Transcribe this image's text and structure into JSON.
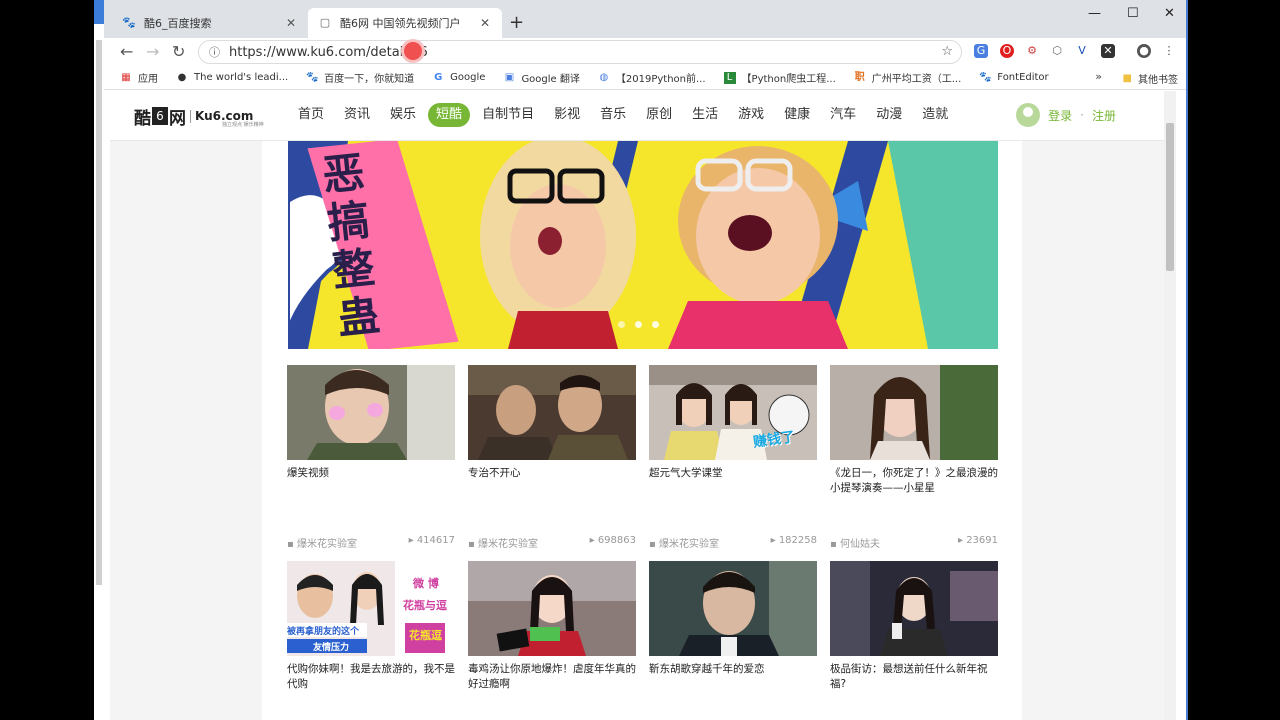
{
  "browser": {
    "tabs": [
      {
        "title": "酷6_百度搜索",
        "active": false
      },
      {
        "title": "酷6网 中国领先视频门户",
        "active": true
      }
    ],
    "url": "https://www.ku6.com/detail/76"
  },
  "bookmarks": {
    "apps_label": "应用",
    "items": [
      {
        "label": "The world's leadi...",
        "icon": "github-icon"
      },
      {
        "label": "百度一下，你就知道",
        "icon": "baidu-paw-icon"
      },
      {
        "label": "Google",
        "icon": "google-icon"
      },
      {
        "label": "Google 翻译",
        "icon": "translate-icon"
      },
      {
        "label": "【2019Python前...",
        "icon": "globe-icon"
      },
      {
        "label": "【Python爬虫工程...",
        "icon": "bookmark-l-icon"
      },
      {
        "label": "广州平均工资（工...",
        "icon": "bookmark-z-icon"
      },
      {
        "label": "FontEditor",
        "icon": "baidu-paw-icon"
      }
    ],
    "more": "»",
    "other": "其他书签"
  },
  "site": {
    "logo_cn_a": "酷",
    "logo_six": "6",
    "logo_cn_b": "网",
    "logo_domain": "Ku6.com",
    "logo_slogan": "独立观点 娱乐精神",
    "nav": [
      "首页",
      "资讯",
      "娱乐",
      "短酷",
      "自制节目",
      "影视",
      "音乐",
      "原创",
      "生活",
      "游戏",
      "健康",
      "汽车",
      "动漫",
      "造就"
    ],
    "nav_active_index": 3,
    "login": "登录",
    "sep": "·",
    "register": "注册",
    "accent": "#77b735"
  },
  "banner": {
    "text": "恶搞整蛊"
  },
  "videos": [
    {
      "title": "爆笑视频",
      "author": "爆米花实验室",
      "plays": "414617"
    },
    {
      "title": "专治不开心",
      "author": "爆米花实验室",
      "plays": "698863"
    },
    {
      "title": "超元气大学课堂",
      "author": "爆米花实验室",
      "plays": "182258",
      "thumb_text": "赚钱了"
    },
    {
      "title": "《龙日一，你死定了！》之最浪漫的小提琴演奏——小星星",
      "author": "何仙姑夫",
      "plays": "23691"
    },
    {
      "title": "代购你妹啊！我是去旅游的，我不是代购",
      "thumb_text_a": "被再拿朋友的这个",
      "thumb_text_b": "友情压力",
      "thumb_text_c": "微 博",
      "thumb_text_d": "花瓶与逗",
      "thumb_text_e": "花瓶逗"
    },
    {
      "title": "毒鸡汤让你原地爆炸！虐度年华真的好过瘾啊"
    },
    {
      "title": "靳东胡歌穿越千年的爱恋"
    },
    {
      "title": "极品街访：最想送前任什么新年祝福?"
    }
  ]
}
